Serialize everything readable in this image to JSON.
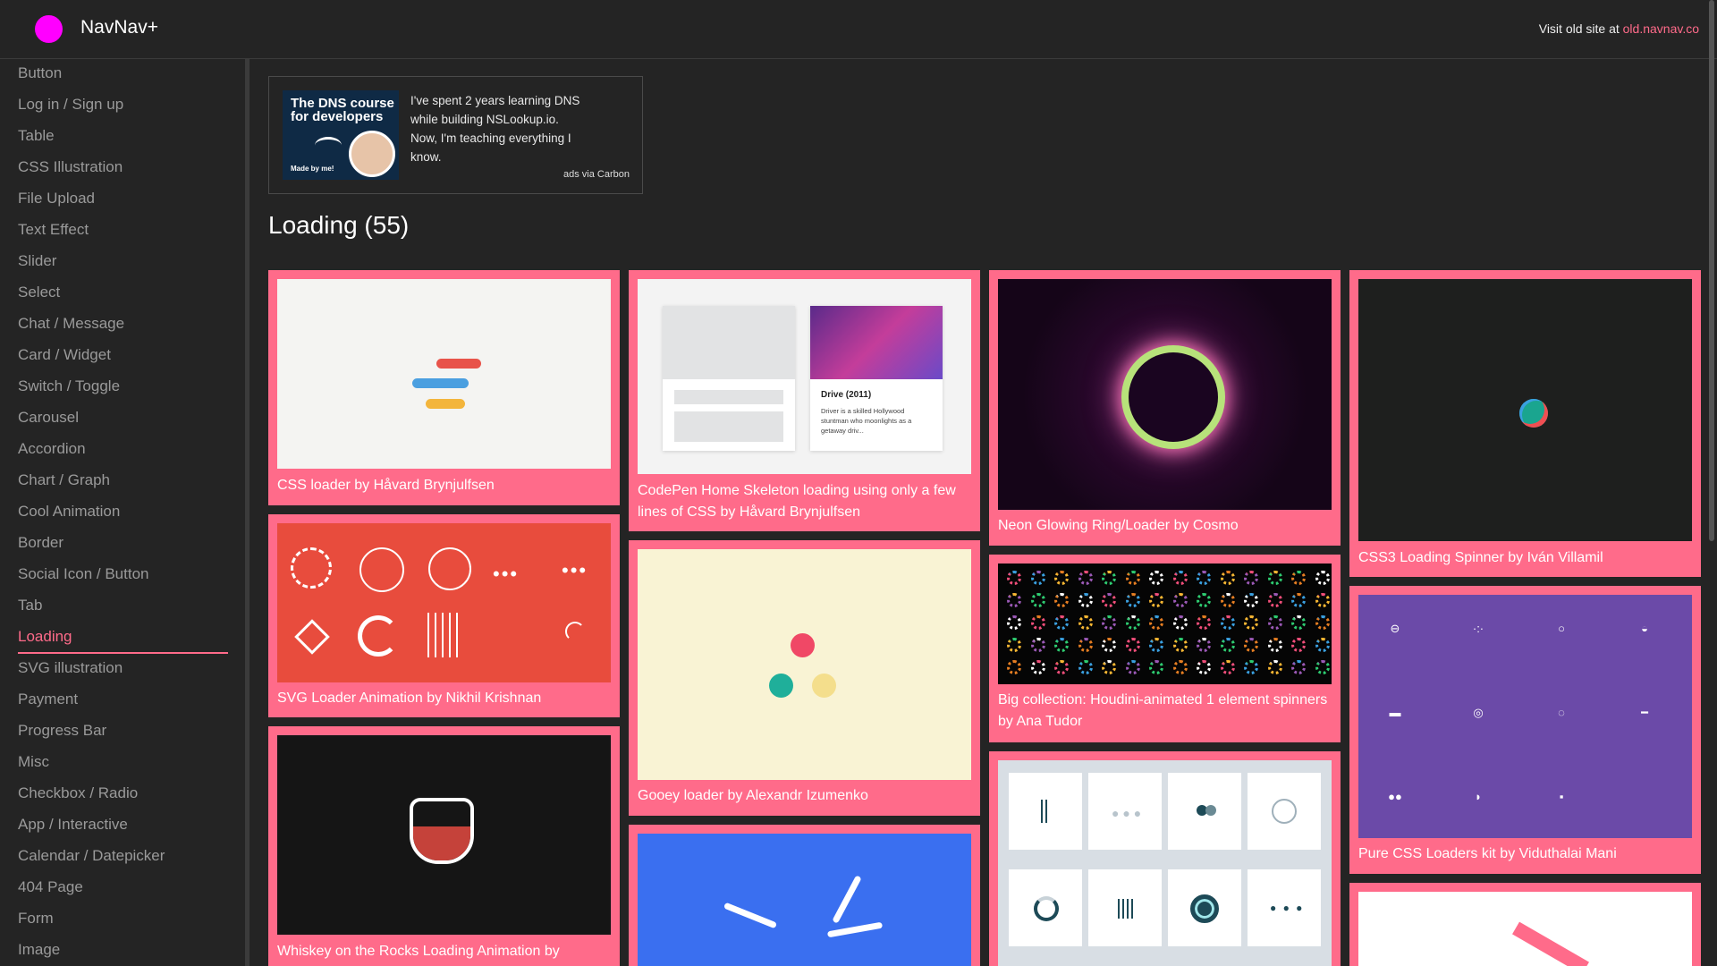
{
  "header": {
    "brand": "NavNav+",
    "old_site_prefix": "Visit old site at ",
    "old_site_link": "old.navnav.co"
  },
  "sidebar": {
    "items": [
      "Button",
      "Log in / Sign up",
      "Table",
      "CSS Illustration",
      "File Upload",
      "Text Effect",
      "Slider",
      "Select",
      "Chat / Message",
      "Card / Widget",
      "Switch / Toggle",
      "Carousel",
      "Accordion",
      "Chart / Graph",
      "Cool Animation",
      "Border",
      "Social Icon / Button",
      "Tab",
      "Loading",
      "SVG illustration",
      "Payment",
      "Progress Bar",
      "Misc",
      "Checkbox / Radio",
      "App / Interactive",
      "Calendar / Datepicker",
      "404 Page",
      "Form",
      "Image"
    ],
    "active": "Loading"
  },
  "ad": {
    "image_title": "The DNS course for developers",
    "image_tag": "Made by me!",
    "text": "I've spent 2 years learning DNS while building NSLookup.io. Now, I'm teaching everything I know.",
    "via": "ads via Carbon"
  },
  "section": {
    "title": "Loading (55)"
  },
  "cards": {
    "c1": "CSS loader by Håvard Brynjulfsen",
    "c2": "SVG Loader Animation by Nikhil Krishnan",
    "c3": "Whiskey on the Rocks Loading Animation by",
    "c4": "CodePen Home Skeleton loading using only a few lines of CSS by Håvard Brynjulfsen",
    "c4_movie_title": "Drive (2011)",
    "c4_movie_desc": "Driver is a skilled Hollywood stuntman who moonlights as a getaway driv...",
    "c5": "Gooey loader by Alexandr Izumenko",
    "c7": "Neon Glowing Ring/Loader by Cosmo",
    "c8": "Big collection: Houdini-animated 1 element spinners by Ana Tudor",
    "c10": "CSS3 Loading Spinner by Iván Villamil",
    "c11": "Pure CSS Loaders kit by Viduthalai Mani"
  },
  "colors": {
    "accent": "#ff6b8a",
    "background": "#242424",
    "logo": "#ff00ff"
  }
}
